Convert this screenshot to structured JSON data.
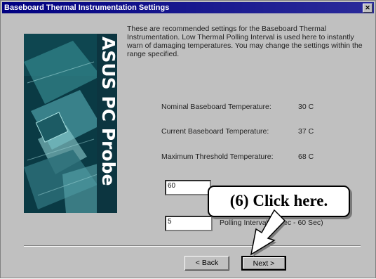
{
  "window": {
    "title": "Baseboard Thermal Instrumentation Settings",
    "close_glyph": "✕"
  },
  "banner": {
    "brand_text": "ASUS PC Probe"
  },
  "description": "These are recommended settings for the Baseboard Thermal Instrumentation. Low Thermal Polling Interval is used here to instantly warn of damaging temperatures. You may change the settings within the range specified.",
  "readings": [
    {
      "label": "Nominal Baseboard Temperature:",
      "value": "30 C"
    },
    {
      "label": "Current Baseboard Temperature:",
      "value": "37 C"
    },
    {
      "label": "Maximum Threshold Temperature:",
      "value": "68 C"
    }
  ],
  "threshold_field": {
    "value": "60"
  },
  "polling": {
    "value": "5",
    "label": "Polling Interval (1 Sec - 60 Sec)"
  },
  "buttons": {
    "back": "< Back",
    "next": "Next >"
  },
  "callout": {
    "text": "(6)  Click here."
  }
}
